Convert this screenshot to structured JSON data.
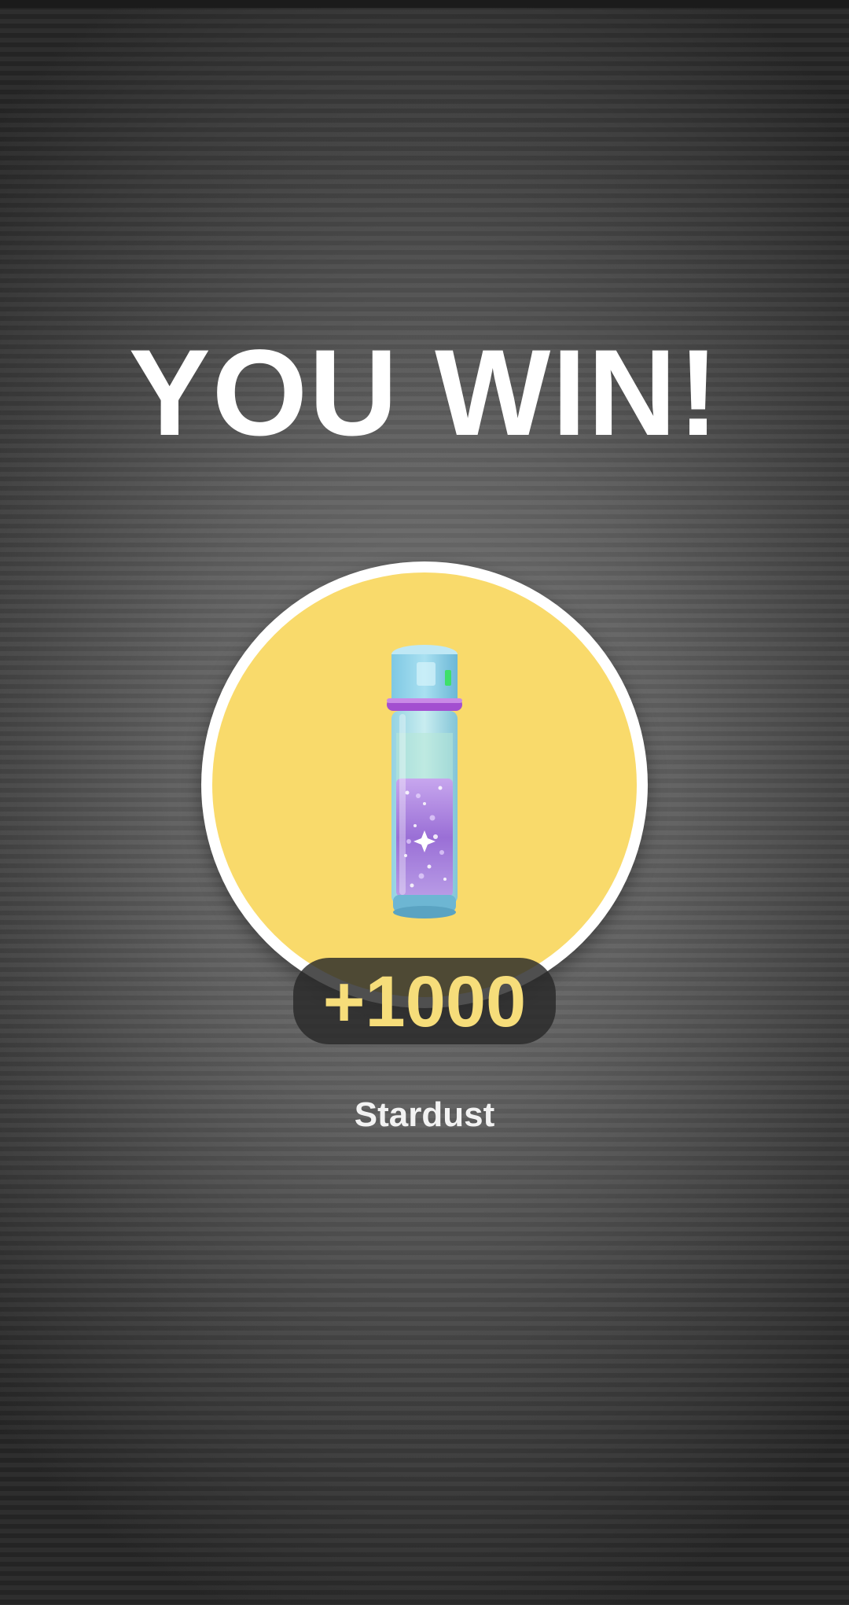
{
  "title": "YOU WIN!",
  "reward": {
    "amount": "+1000",
    "name": "Stardust",
    "icon": "stardust-vial-icon"
  },
  "colors": {
    "circle_fill": "#f9da6b",
    "amount_text": "#f6dd7a",
    "pill_bg": "#282828"
  }
}
